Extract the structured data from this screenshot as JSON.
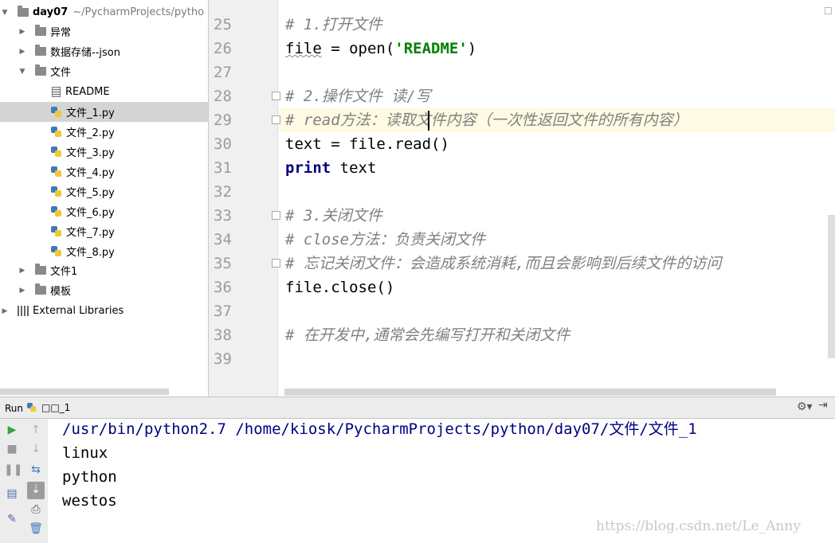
{
  "project": {
    "root_name": "day07",
    "root_path": "~/PycharmProjects/pytho",
    "items": [
      {
        "label": "异常",
        "kind": "folder",
        "expanded": false
      },
      {
        "label": "数据存储--json",
        "kind": "folder",
        "expanded": false
      },
      {
        "label": "文件",
        "kind": "folder",
        "expanded": true
      },
      {
        "label": "README",
        "kind": "file"
      },
      {
        "label": "文件_1.py",
        "kind": "py",
        "selected": true
      },
      {
        "label": "文件_2.py",
        "kind": "py"
      },
      {
        "label": "文件_3.py",
        "kind": "py"
      },
      {
        "label": "文件_4.py",
        "kind": "py"
      },
      {
        "label": "文件_5.py",
        "kind": "py"
      },
      {
        "label": "文件_6.py",
        "kind": "py"
      },
      {
        "label": "文件_7.py",
        "kind": "py"
      },
      {
        "label": "文件_8.py",
        "kind": "py"
      },
      {
        "label": "文件1",
        "kind": "folder",
        "expanded": false
      },
      {
        "label": "模板",
        "kind": "folder",
        "expanded": false
      }
    ],
    "external_libraries": "External Libraries"
  },
  "editor": {
    "line_numbers": [
      "25",
      "26",
      "27",
      "28",
      "29",
      "30",
      "31",
      "32",
      "33",
      "34",
      "35",
      "36",
      "37",
      "38",
      "39"
    ],
    "lines": {
      "l25": "# 1.打开文件",
      "l26_a": "file",
      "l26_b": " = open(",
      "l26_c": "'README'",
      "l26_d": ")",
      "l28": "# 2.操作文件 读/写",
      "l29": "# read方法：读取文件内容（一次性返回文件的所有内容）",
      "l30": "text = file.read()",
      "l31_kw": "print",
      "l31_b": " text",
      "l33": "# 3.关闭文件",
      "l34": "# close方法：负责关闭文件",
      "l35": "# 忘记关闭文件：会造成系统消耗,而且会影响到后续文件的访问",
      "l36": "file.close()",
      "l38": "# 在开发中,通常会先编写打开和关闭文件"
    }
  },
  "run": {
    "label": "Run",
    "tab": "□□_1",
    "output": [
      "/usr/bin/python2.7 /home/kiosk/PycharmProjects/python/day07/文件/文件_1",
      "linux",
      "python",
      "westos"
    ]
  },
  "watermark": "https://blog.csdn.net/Le_Anny",
  "colors": {
    "keyword": "#000080",
    "string": "#008000",
    "comment": "#808080",
    "current_line": "#fffae3",
    "console_cmd": "#000080",
    "selected_row": "#d4d4d4"
  }
}
